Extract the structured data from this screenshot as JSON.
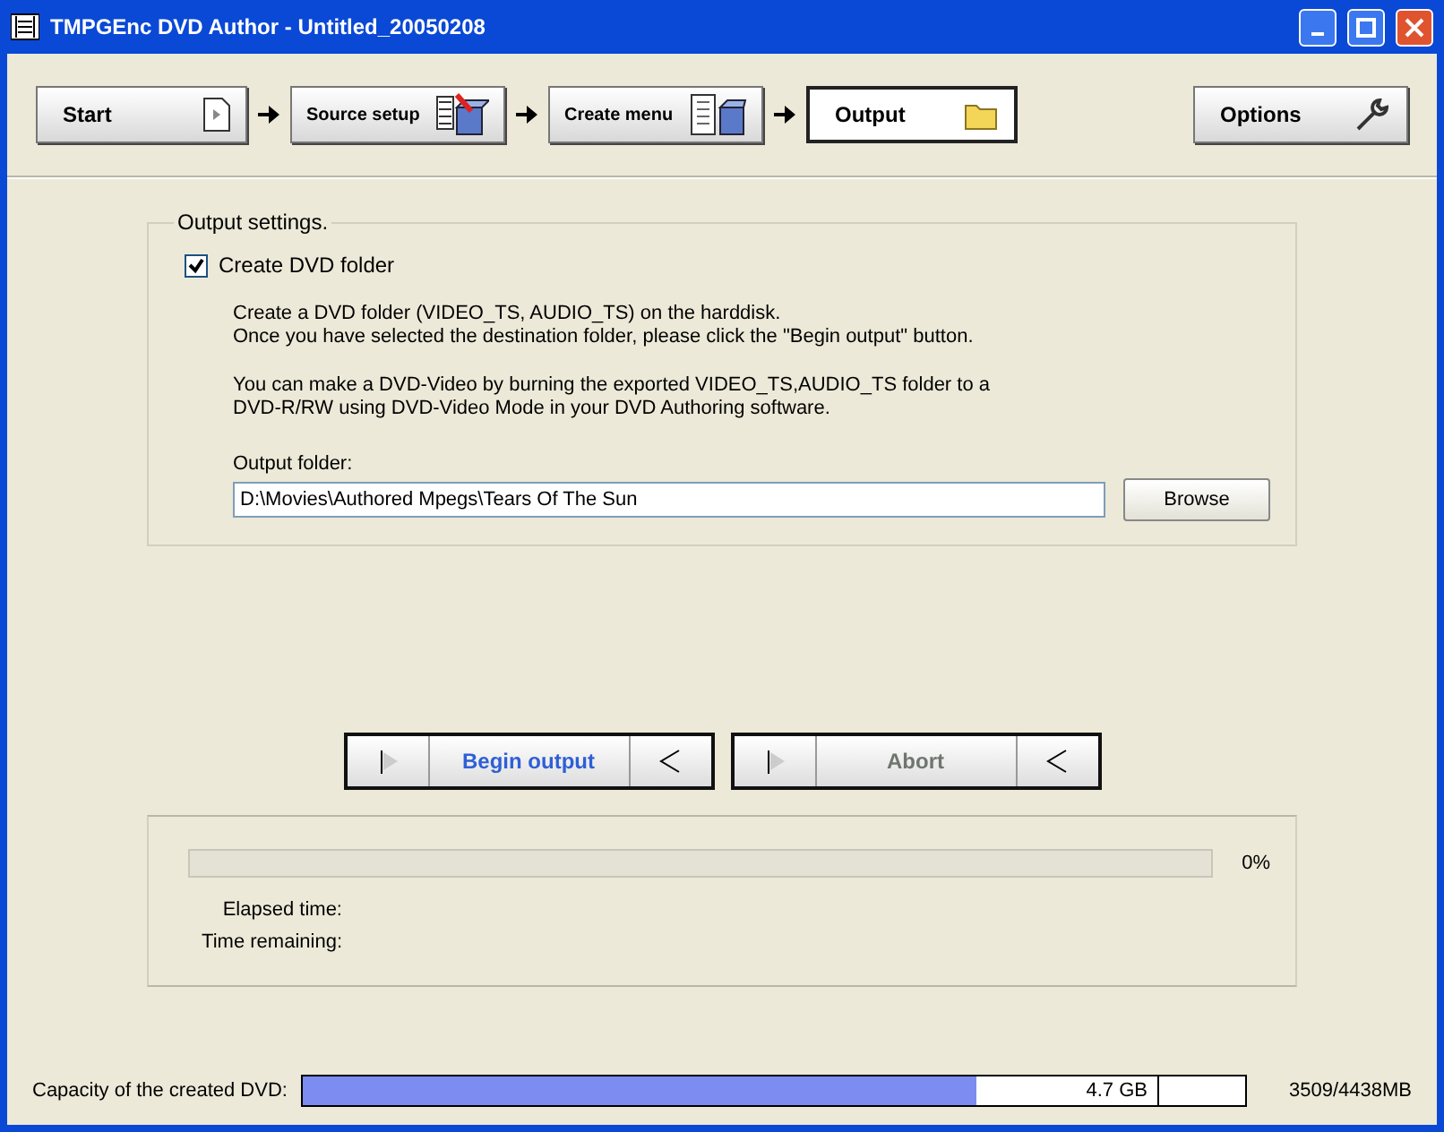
{
  "window": {
    "title": "TMPGEnc DVD Author - Untitled_20050208"
  },
  "steps": [
    {
      "label": "Start",
      "selected": false
    },
    {
      "label": "Source setup",
      "selected": false
    },
    {
      "label": "Create menu",
      "selected": false
    },
    {
      "label": "Output",
      "selected": true
    }
  ],
  "options_button": {
    "label": "Options"
  },
  "output_settings": {
    "title": "Output settings.",
    "create_folder": {
      "label": "Create DVD folder",
      "checked": true
    },
    "paragraphs": [
      "Create a DVD folder (VIDEO_TS, AUDIO_TS) on the harddisk.\nOnce you have selected the destination folder, please click the \"Begin output\" button.",
      "You can make a DVD-Video by burning the exported VIDEO_TS,AUDIO_TS folder to a\nDVD-R/RW using DVD-Video Mode in your DVD Authoring software."
    ],
    "folder_label": "Output folder:",
    "folder_value": "D:\\Movies\\Authored Mpegs\\Tears Of The Sun",
    "browse": "Browse"
  },
  "actions": [
    {
      "label": "Begin output",
      "disabled": false
    },
    {
      "label": "Abort",
      "disabled": true
    }
  ],
  "progress": {
    "level": 0,
    "reading": "0%",
    "elapsed_label": "Elapsed time:",
    "remaining_label": "Time remaining:"
  },
  "capacity": {
    "label": "Capacity of the created DVD:",
    "level": 0.714,
    "marker": "4.7 GB",
    "reading": "3509/4438MB"
  }
}
